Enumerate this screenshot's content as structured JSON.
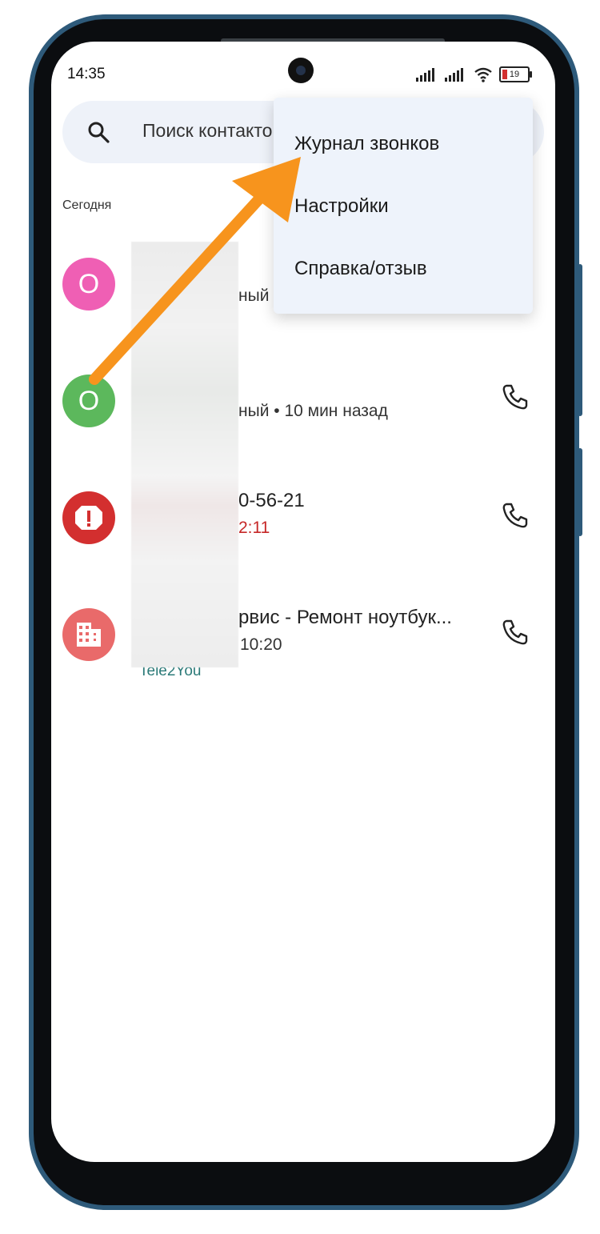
{
  "status_bar": {
    "time": "14:35",
    "battery": "19",
    "signal_icon": "signal-bars-icon",
    "wifi_icon": "wifi-icon"
  },
  "search": {
    "placeholder": "Поиск контакто",
    "icon": "search-icon"
  },
  "section_label": "Сегодня",
  "calls": [
    {
      "avatar": "О",
      "avatar_color": "#ef5fb4",
      "line1": "",
      "line2": "ный"
    },
    {
      "avatar": "О",
      "avatar_color": "#5cb85c",
      "line1": "",
      "line2": "ный • 10 мин назад"
    },
    {
      "avatar": "!",
      "avatar_color": "#d32f2f",
      "line1": "0-56-21",
      "line2": "2:11",
      "line2_color": "#c62828"
    },
    {
      "avatar": "building",
      "avatar_color": "#e96a6a",
      "line1": "рвис - Ремонт ноутбук...",
      "line2": "10:20",
      "line3": "Tele2You"
    }
  ],
  "menu": {
    "items": [
      {
        "label": "Журнал звонков"
      },
      {
        "label": "Настройки"
      },
      {
        "label": "Справка/отзыв"
      }
    ]
  },
  "annotation": {
    "arrow_color": "#f7941d"
  }
}
